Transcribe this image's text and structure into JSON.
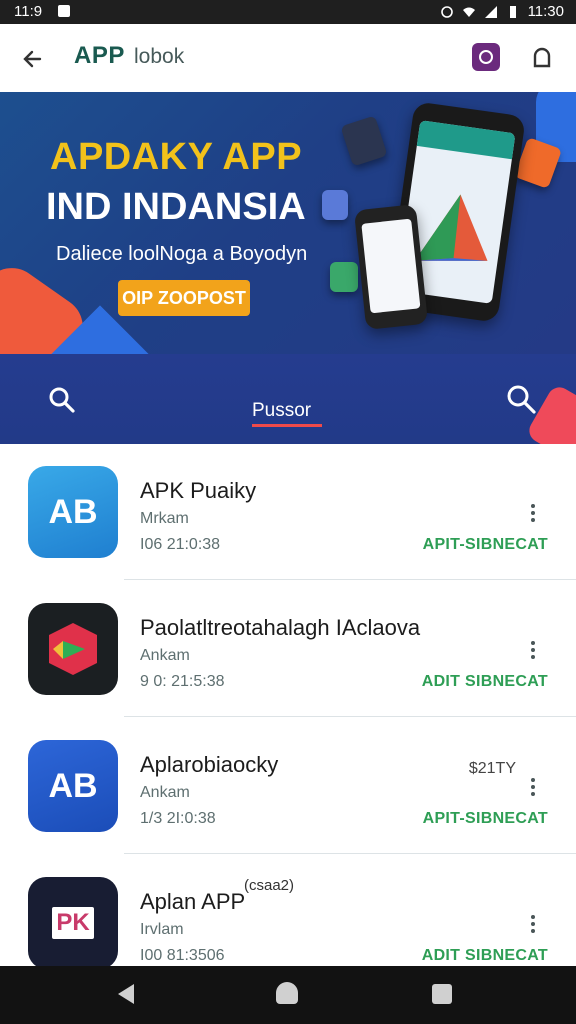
{
  "status_bar": {
    "time_left": "11:9",
    "time_right": "11:30"
  },
  "app_bar": {
    "title": "APP",
    "subtitle": "lobok"
  },
  "banner": {
    "title_line1": "APDAKY APP",
    "title_line2": "IND INDANSIA",
    "subtitle": "Daliece loolNoga a Boyodyn",
    "button_label": "OIP ZOOPOST"
  },
  "search_band": {
    "tab_label": "Pussor"
  },
  "apps": [
    {
      "name": "APK Puaiky",
      "developer": "Mrkam",
      "meta": "I06 21:0:38",
      "action": "APIT-SIBNECAT",
      "icon": "ab-icon",
      "price": "",
      "extra": ""
    },
    {
      "name": "Paolatltreotahalagh IAclaova",
      "developer": "Ankam",
      "meta": "9 0: 21:5:38",
      "action": "ADIT SIBNECAT",
      "icon": "gem-icon",
      "price": "",
      "extra": ""
    },
    {
      "name": "Aplarobiaocky",
      "developer": "Ankam",
      "meta": "1/3 2I:0:38",
      "action": "APIT-SIBNECAT",
      "icon": "ab2-icon",
      "price": "$21TY",
      "extra": ""
    },
    {
      "name": "Aplan APP",
      "developer": "Irvlam",
      "meta": "I00 81:3506",
      "action": "ADIT SIBNECAT",
      "icon": "pk-icon",
      "price": "",
      "extra": "(csaa2)"
    }
  ],
  "icon_letters": {
    "ab": "AB",
    "ab2": "AB",
    "pk": "PK"
  },
  "colors": {
    "primary_green": "#2e9e55",
    "banner_blue": "#1f3f86",
    "accent_yellow": "#f2c21b",
    "accent_orange": "#f2a31b"
  }
}
